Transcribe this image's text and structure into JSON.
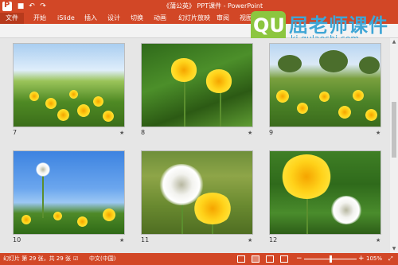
{
  "window": {
    "title": "《蒲公英》 PPT课件 - PowerPoint"
  },
  "ribbon": {
    "tabs": [
      "文件",
      "开始",
      "iSlide",
      "插入",
      "设计",
      "切换",
      "动画",
      "幻灯片放映",
      "审阅",
      "视图"
    ]
  },
  "watermark": {
    "badge": "QU",
    "title": "屈老师课件",
    "url": "kj.qulaoshi.com"
  },
  "slides": [
    {
      "number": "7",
      "scene": "meadow-sky"
    },
    {
      "number": "8",
      "scene": "dandelion-closeup"
    },
    {
      "number": "9",
      "scene": "field-with-trees"
    },
    {
      "number": "10",
      "scene": "blue-sky-seedhead"
    },
    {
      "number": "11",
      "scene": "seedhead-and-flower"
    },
    {
      "number": "12",
      "scene": "flower-and-seedhead"
    }
  ],
  "statusbar": {
    "slide_info": "幻灯片 第 29 张，共 29 张",
    "language": "中文(中国)",
    "zoom": "105%",
    "minus": "−",
    "plus": "+"
  },
  "icons": {
    "app": "powerpoint-icon",
    "star": "transition-star-icon"
  },
  "colors": {
    "accent": "#d24726",
    "watermark_green": "#8cc63f",
    "watermark_blue": "#3fa6d6"
  }
}
